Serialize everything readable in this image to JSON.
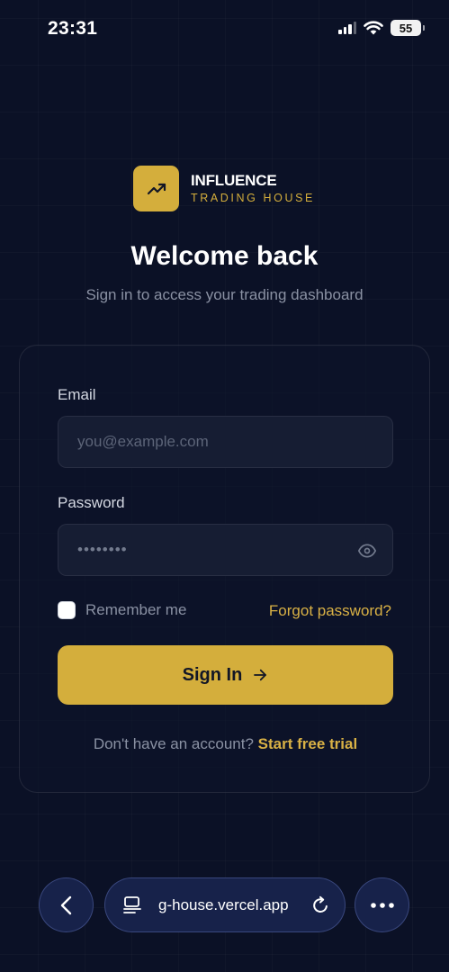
{
  "status_bar": {
    "time": "23:31",
    "battery": "55",
    "icons": [
      "cellular-signal-icon",
      "wifi-icon",
      "battery-icon"
    ]
  },
  "brand": {
    "name": "INFLUENCE",
    "subtitle": "TRADING HOUSE",
    "logo_icon": "trending-up-icon"
  },
  "header": {
    "title": "Welcome back",
    "subtitle": "Sign in to access your trading dashboard"
  },
  "form": {
    "email": {
      "label": "Email",
      "placeholder": "you@example.com",
      "value": ""
    },
    "password": {
      "label": "Password",
      "masked_value": "••••••••",
      "visibility_icon": "eye-icon"
    },
    "remember_label": "Remember me",
    "remember_checked": false,
    "forgot_link": "Forgot password?",
    "submit_label": "Sign In",
    "submit_icon": "arrow-right-icon",
    "signup_prompt": "Don't have an account?",
    "signup_link": "Start free trial"
  },
  "browser": {
    "url": "g-house.vercel.app",
    "icons": [
      "back-chevron-icon",
      "page-menu-icon",
      "reload-icon",
      "more-icon"
    ]
  },
  "colors": {
    "background": "#0b1126",
    "accent": "#d4ae3c",
    "muted_text": "#8a91a3",
    "input_bg": "#161d33"
  }
}
